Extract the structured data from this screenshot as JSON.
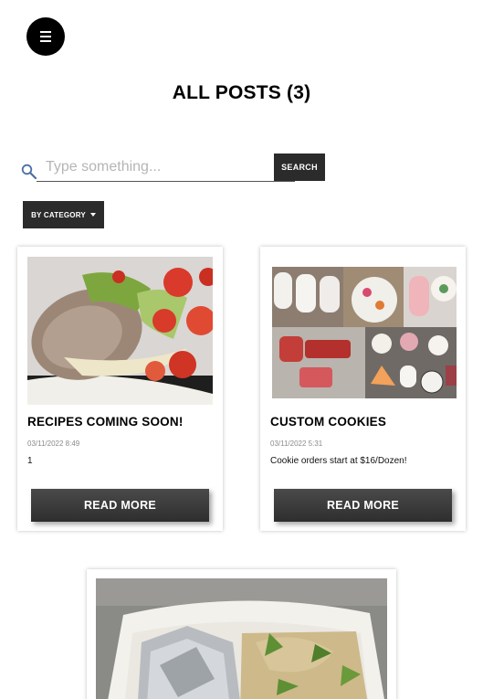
{
  "header": {
    "menu_icon": "hamburger-menu-icon",
    "page_title": "ALL POSTS (3)"
  },
  "search": {
    "placeholder": "Type something...",
    "value": "",
    "button_label": "SEARCH",
    "icon": "search-icon"
  },
  "filter": {
    "category_label": "BY CATEGORY",
    "icon": "caret-down-icon"
  },
  "posts": [
    {
      "title": "RECIPES COMING SOON!",
      "date": "03/11/2022 8:49",
      "excerpt": "1",
      "button_label": "READ MORE"
    },
    {
      "title": "CUSTOM COOKIES",
      "date": "03/11/2022 5:31",
      "excerpt": "Cookie orders start at $16/Dozen!",
      "button_label": "READ MORE"
    },
    {
      "title": "",
      "date": "",
      "excerpt": "",
      "button_label": ""
    }
  ],
  "colors": {
    "button_bg": "#2b2b2b",
    "text": "#000000",
    "date": "#8a8a8a"
  }
}
